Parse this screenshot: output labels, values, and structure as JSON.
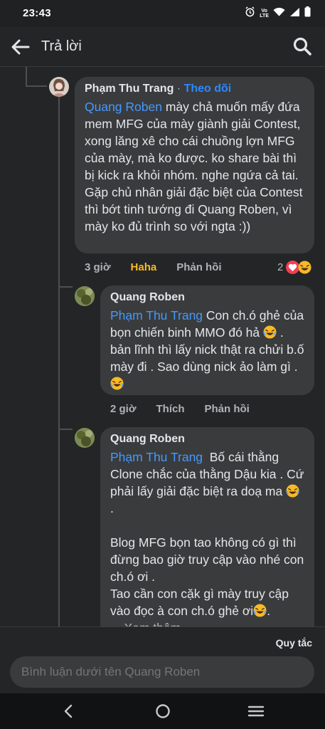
{
  "status": {
    "time": "23:43",
    "net_label": "Vo\nLTE"
  },
  "appbar": {
    "title": "Trả lời"
  },
  "comments": [
    {
      "author": "Phạm Thu Trang",
      "follow": "Theo dõi",
      "separator": " · ",
      "mention": "Quang Roben",
      "text": " mày chả muốn mấy đứa mem MFG của mày giành giải Contest, xong lăng xê cho cái chuồng lợn MFG của mày, mà ko được. ko share bài thì bị kick ra khỏi nhóm. nghe ngứa cả tai. Gặp chủ nhân giải đặc biệt của Contest thì bớt tinh tướng đi Quang Roben, vì mày ko đủ trình so với ngta :))",
      "time": "3 giờ",
      "reaction_label": "Haha",
      "reply": "Phản hồi",
      "reaction_count": "2"
    },
    {
      "author": "Quang Roben",
      "mention": "Phạm Thu Trang",
      "text1": " Con ch.ó ghẻ của bọn chiến binh MMO đó hả",
      "text2": " . bản lĩnh thì lấy nick thật ra chửi b.ố mày đi . Sao dùng nick ảo làm gì .",
      "time": "2 giờ",
      "like": "Thích",
      "reply": "Phản hồi"
    },
    {
      "author": "Quang Roben",
      "mention": "Phạm Thu Trang",
      "text1": "  Bố cái thằng Clone chắc của thằng Dậu kia . Cứ phải lấy giải đặc biệt ra doạ ma",
      "text2": " .",
      "text3": "Blog MFG bọn tao không có gì thì đừng bao giờ truy cập vào nhé con ch.ó ơi .\nTao cần con cặk gì mày truy cập vào đọc à con ch.ó ghẻ ơi",
      "see_more": "... Xem thêm"
    }
  ],
  "composer": {
    "rules": "Quy tắc",
    "placeholder": "Bình luận dưới tên Quang Roben"
  },
  "colors": {
    "accent": "#2d88ff",
    "haha": "#f7b928",
    "bubble": "#3a3b3c",
    "background": "#242526"
  },
  "icons": [
    "back-arrow-icon",
    "search-icon",
    "alarm-icon",
    "wifi-icon",
    "signal-icon",
    "battery-icon",
    "heart-icon",
    "laugh-emoji-icon",
    "nav-back-icon",
    "nav-home-icon",
    "nav-recents-icon"
  ]
}
